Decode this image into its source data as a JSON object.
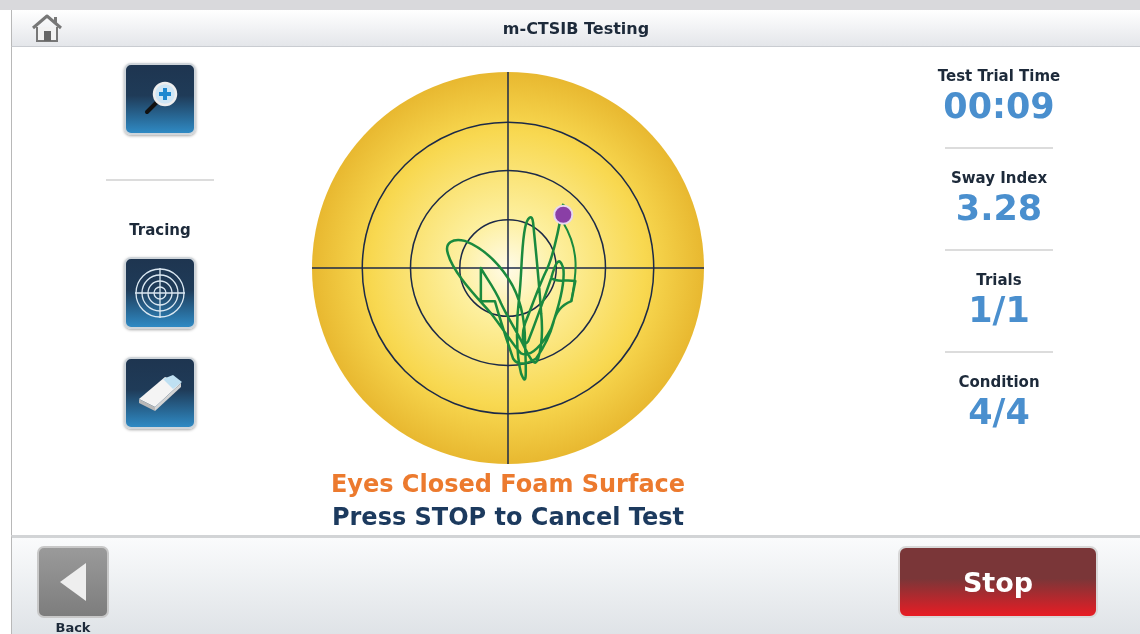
{
  "window": {
    "title": "m-CTSIB Testing"
  },
  "tools": {
    "section_label": "Tracing"
  },
  "stats": [
    {
      "label": "Test Trial Time",
      "value": "00:09"
    },
    {
      "label": "Sway Index",
      "value": "3.28"
    },
    {
      "label": "Trials",
      "value": "1/1"
    },
    {
      "label": "Condition",
      "value": "4/4"
    }
  ],
  "messages": [
    {
      "kind": "condition",
      "text": "Eyes Closed Foam Surface"
    },
    {
      "kind": "instruction",
      "text": "Press STOP to Cancel Test"
    }
  ],
  "footer": {
    "back_label": "Back",
    "stop_label": "Stop"
  }
}
